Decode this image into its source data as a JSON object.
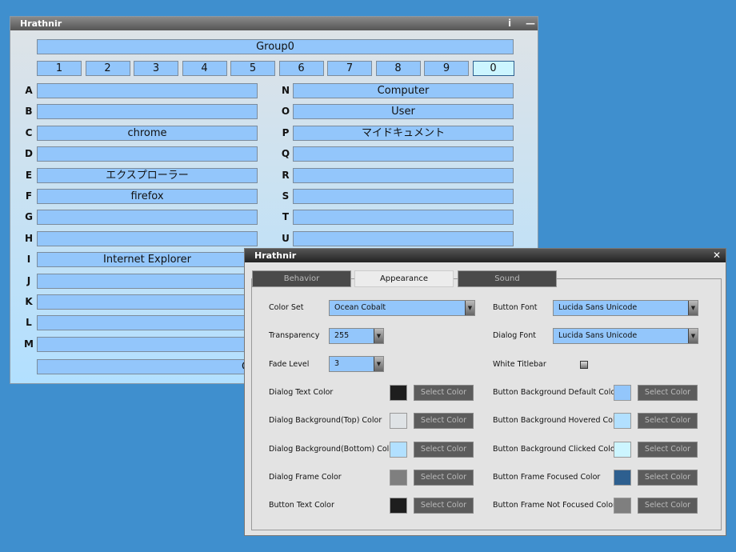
{
  "main": {
    "title": "Hrathnir",
    "info_icon": "info-icon",
    "minimize_icon": "minimize-icon",
    "group": "Group0",
    "numbers": [
      "1",
      "2",
      "3",
      "4",
      "5",
      "6",
      "7",
      "8",
      "9",
      "0"
    ],
    "selected_number": "0",
    "left": [
      {
        "k": "A",
        "v": ""
      },
      {
        "k": "B",
        "v": ""
      },
      {
        "k": "C",
        "v": "chrome"
      },
      {
        "k": "D",
        "v": ""
      },
      {
        "k": "E",
        "v": "エクスプローラー"
      },
      {
        "k": "F",
        "v": "firefox"
      },
      {
        "k": "G",
        "v": ""
      },
      {
        "k": "H",
        "v": ""
      },
      {
        "k": "I",
        "v": "Internet Explorer"
      },
      {
        "k": "J",
        "v": ""
      },
      {
        "k": "K",
        "v": ""
      },
      {
        "k": "L",
        "v": ""
      },
      {
        "k": "M",
        "v": ""
      }
    ],
    "right": [
      {
        "k": "N",
        "v": "Computer"
      },
      {
        "k": "O",
        "v": "User"
      },
      {
        "k": "P",
        "v": "マイドキュメント"
      },
      {
        "k": "Q",
        "v": ""
      },
      {
        "k": "R",
        "v": ""
      },
      {
        "k": "S",
        "v": ""
      },
      {
        "k": "T",
        "v": ""
      },
      {
        "k": "U",
        "v": ""
      }
    ],
    "bottom": "C"
  },
  "dialog": {
    "title": "Hrathnir",
    "close_icon": "close-icon",
    "tabs": [
      "Behavior",
      "Appearance",
      "Sound"
    ],
    "active_tab": "Appearance",
    "color_set": {
      "label": "Color Set",
      "value": "Ocean Cobalt"
    },
    "transparency": {
      "label": "Transparency",
      "value": "255"
    },
    "fade": {
      "label": "Fade Level",
      "value": "3"
    },
    "button_font": {
      "label": "Button Font",
      "value": "Lucida Sans Unicode"
    },
    "dialog_font": {
      "label": "Dialog Font",
      "value": "Lucida Sans Unicode"
    },
    "white_titlebar": {
      "label": "White Titlebar",
      "checked": false
    },
    "select_label": "Select Color",
    "left_colors": [
      {
        "label": "Dialog Text Color",
        "color": "#1e1e1e"
      },
      {
        "label": "Dialog Background(Top) Color",
        "color": "#dfe3e6"
      },
      {
        "label": "Dialog Background(Bottom) Color",
        "color": "#b2e0ff"
      },
      {
        "label": "Dialog Frame Color",
        "color": "#7f7f7f"
      },
      {
        "label": "Button Text Color",
        "color": "#1e1e1e"
      }
    ],
    "right_colors": [
      {
        "label": "Button Background Default Color",
        "color": "#93c6fb"
      },
      {
        "label": "Button Background Hovered Color",
        "color": "#b2e0ff"
      },
      {
        "label": "Button Background Clicked Color",
        "color": "#ccf5ff"
      },
      {
        "label": "Button Frame Focused Color",
        "color": "#2d5f8f"
      },
      {
        "label": "Button Frame Not Focused Color",
        "color": "#7f7f7f"
      }
    ]
  }
}
